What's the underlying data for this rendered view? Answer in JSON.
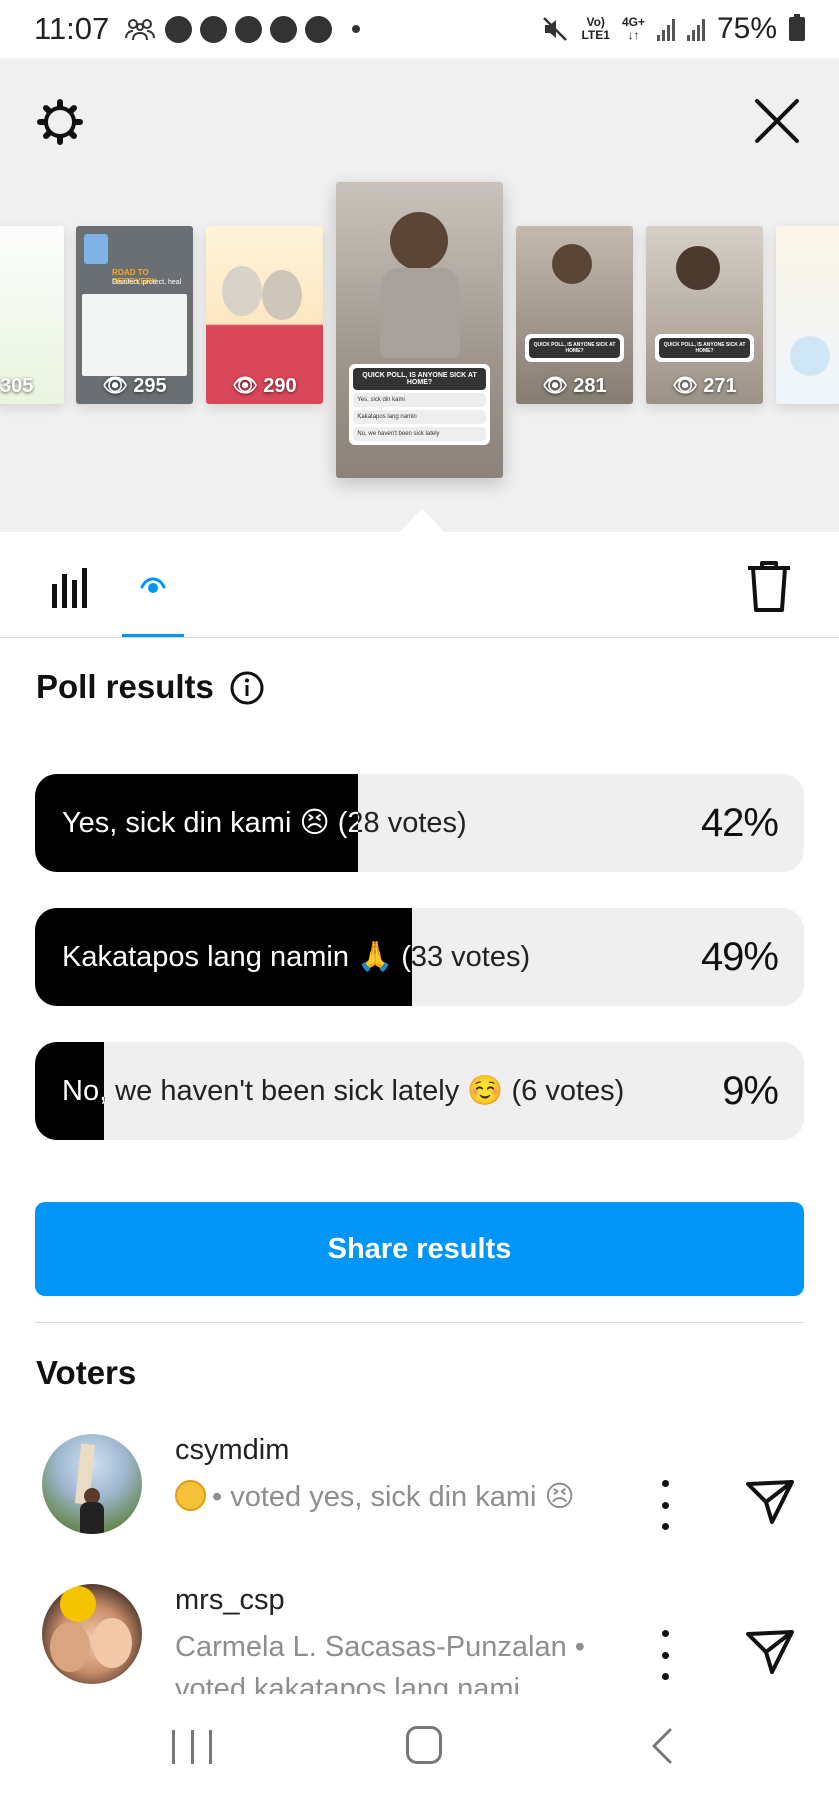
{
  "status_bar": {
    "time": "11:07",
    "network_top": "Vo)",
    "network_bottom": "LTE1",
    "net2_top": "4G+",
    "net2_bottom": "↓↑",
    "battery": "75%"
  },
  "header": {
    "settings_icon": "gear-icon",
    "close_icon": "close-icon"
  },
  "story_thumbnails": [
    {
      "views": "305"
    },
    {
      "views": "295",
      "title": "ROAD TO RECOVERY",
      "subtitle": "Disinfect, protect, heal"
    },
    {
      "views": "290"
    },
    {
      "poll_question": "QUICK POLL, IS ANYONE SICK AT HOME?",
      "options": [
        "Yes, sick din kami",
        "Kakatapos lang namin",
        "No, we haven't been sick lately"
      ]
    },
    {
      "views": "281",
      "poll_question": "QUICK POLL, IS ANYONE SICK AT HOME?"
    },
    {
      "views": "271",
      "poll_question": "QUICK POLL, IS ANYONE SICK AT HOME?"
    },
    {
      "views": ""
    }
  ],
  "tabs": {
    "insights_icon": "bar-chart-icon",
    "viewers_icon": "eye-icon",
    "delete_icon": "trash-icon"
  },
  "poll": {
    "title": "Poll results",
    "info_icon": "info-icon",
    "options": [
      {
        "label": "Yes, sick din kami 😣 (28 votes)",
        "percent": "42%",
        "fill": 0.42
      },
      {
        "label": "Kakatapos lang namin 🙏 (33 votes)",
        "percent": "49%",
        "fill": 0.49
      },
      {
        "label": "No, we haven't been sick lately ☺️ (6 votes)",
        "percent": "9%",
        "fill": 0.09
      }
    ],
    "share_label": "Share results"
  },
  "voters": {
    "title": "Voters",
    "items": [
      {
        "username": "csymdim",
        "vote_text": "• voted yes, sick din kami 😣"
      },
      {
        "username": "mrs_csp",
        "vote_text": "Carmela L. Sacasas-Punzalan • voted kakatapos lang nami..."
      }
    ]
  },
  "colors": {
    "accent": "#0095f6",
    "bar_fill": "#000000",
    "bar_track": "#efefef"
  }
}
